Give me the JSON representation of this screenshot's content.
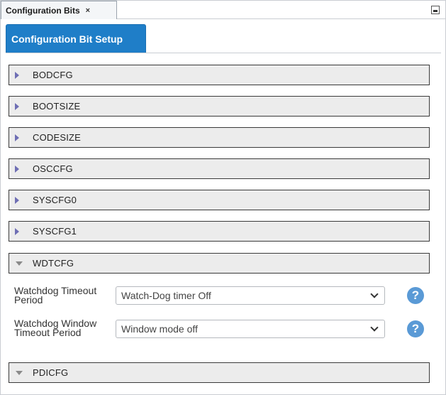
{
  "window_tab": {
    "title": "Configuration Bits",
    "close_glyph": "×"
  },
  "setup_tab": {
    "label": "Configuration Bit Setup"
  },
  "sections": [
    {
      "label": "BODCFG",
      "expanded": false
    },
    {
      "label": "BOOTSIZE",
      "expanded": false
    },
    {
      "label": "CODESIZE",
      "expanded": false
    },
    {
      "label": "OSCCFG",
      "expanded": false
    },
    {
      "label": "SYSCFG0",
      "expanded": false
    },
    {
      "label": "SYSCFG1",
      "expanded": false
    },
    {
      "label": "WDTCFG",
      "expanded": true
    },
    {
      "label": "PDICFG",
      "expanded": false
    }
  ],
  "wdtcfg_settings": [
    {
      "label": "Watchdog Timeout Period",
      "value": "Watch-Dog timer Off",
      "help": "?"
    },
    {
      "label": "Watchdog Window Timeout Period",
      "value": "Window mode off",
      "help": "?"
    }
  ],
  "icons": {
    "collapsed": "triangle-right-icon",
    "expanded": "triangle-down-icon",
    "help": "help-icon",
    "minimize": "minimize-icon",
    "dropdown": "chevron-down-icon"
  },
  "colors": {
    "accent_blue": "#1f7ec8",
    "help_blue": "#5a9ad6",
    "section_bg": "#ececec",
    "collapsed_triangle": "#6e6eb4"
  }
}
